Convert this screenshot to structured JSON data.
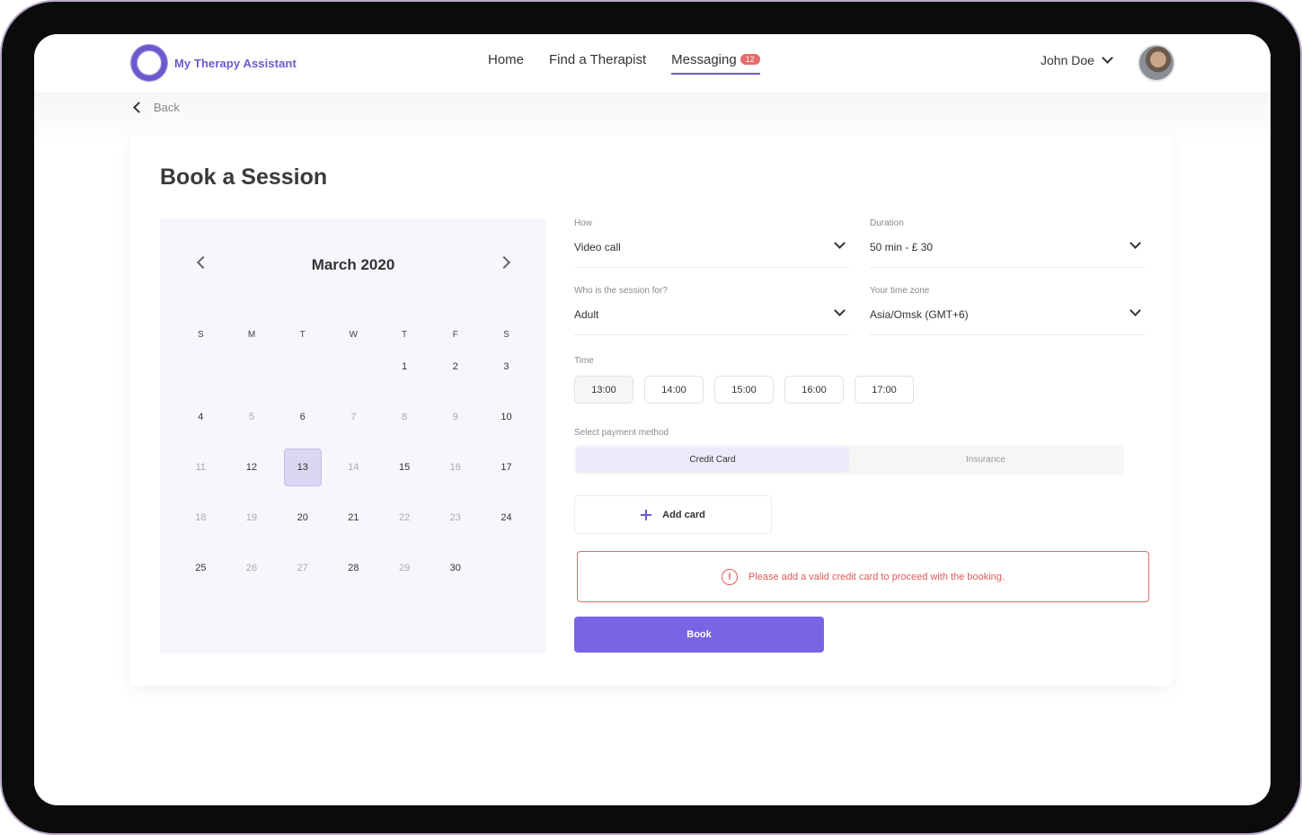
{
  "header": {
    "logo_text": "My Therapy Assistant",
    "nav": [
      {
        "label": "Home"
      },
      {
        "label": "Find a Therapist"
      },
      {
        "label": "Messaging",
        "badge": "12"
      }
    ],
    "user_name": "John Doe"
  },
  "back_label": "Back",
  "title": "Book a Session",
  "calendar": {
    "month": "March 2020",
    "weekdays": [
      "S",
      "M",
      "T",
      "W",
      "T",
      "F",
      "S"
    ],
    "weeks": [
      [
        "",
        "",
        "",
        "",
        "1",
        "2",
        "3"
      ],
      [
        "4",
        "5",
        "6",
        "7",
        "8",
        "9",
        "10"
      ],
      [
        "11",
        "12",
        "13",
        "14",
        "15",
        "16",
        "17"
      ],
      [
        "18",
        "19",
        "20",
        "21",
        "22",
        "23",
        "24"
      ],
      [
        "25",
        "26",
        "27",
        "28",
        "29",
        "30",
        ""
      ]
    ],
    "muted_days": [
      "5",
      "7",
      "8",
      "9",
      "11",
      "14",
      "16",
      "18",
      "19",
      "22",
      "23",
      "26",
      "27",
      "29"
    ],
    "selected_day": "13"
  },
  "form": {
    "how": {
      "label": "How",
      "value": "Video call"
    },
    "duration": {
      "label": "Duration",
      "value": "50 min - £ 30"
    },
    "session_for": {
      "label": "Who is the session for?",
      "value": "Adult"
    },
    "timezone": {
      "label": "Your time zone",
      "value": "Asia/Omsk (GMT+6)"
    },
    "time_label": "Time",
    "times": [
      "13:00",
      "14:00",
      "15:00",
      "16:00",
      "17:00"
    ],
    "selected_time": "13:00",
    "payment_label": "Select payment method",
    "payment_tabs": [
      "Credit Card",
      "Insurance"
    ],
    "add_card_label": "Add card",
    "error_message": "Please add a valid credit card to proceed with the booking.",
    "book_label": "Book"
  },
  "colors": {
    "accent": "#7b63e6",
    "error": "#e05a5a",
    "badge": "#e76a6a"
  }
}
